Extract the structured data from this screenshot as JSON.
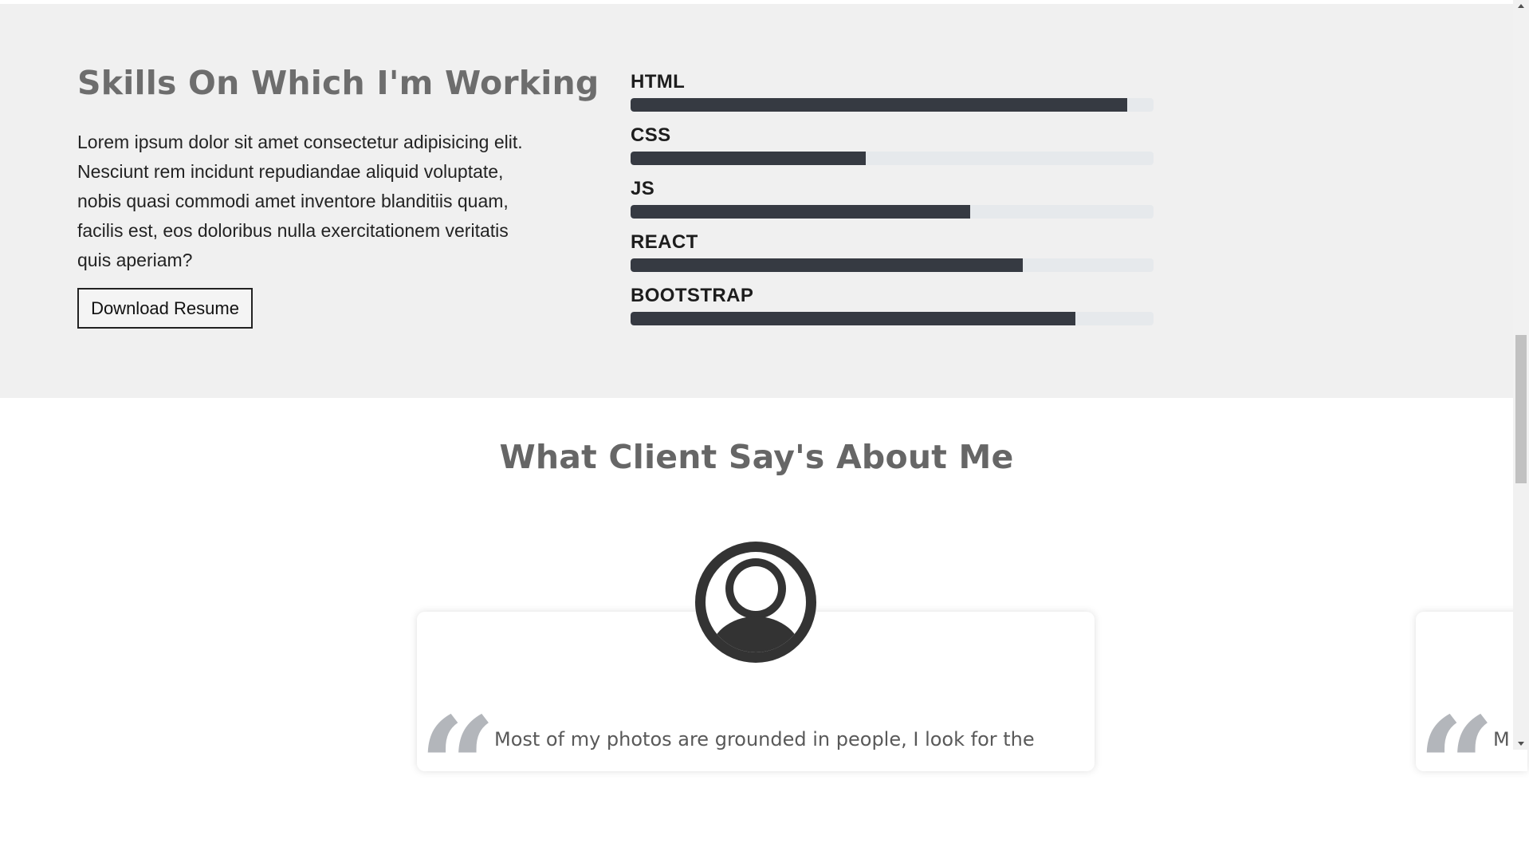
{
  "skills_section": {
    "title": "Skills On Which I'm Working",
    "description": "Lorem ipsum dolor sit amet consectetur adipisicing elit. Nesciunt rem incidunt repudiandae aliquid voluptate, nobis quasi commodi amet inventore blanditiis quam, facilis est, eos doloribus nulla exercitationem veritatis quis aperiam?",
    "resume_button": "Download Resume",
    "skills": [
      {
        "label": "HTML",
        "percent": 95
      },
      {
        "label": "CSS",
        "percent": 45
      },
      {
        "label": "JS",
        "percent": 65
      },
      {
        "label": "REACT",
        "percent": 75
      },
      {
        "label": "BOOTSTRAP",
        "percent": 85
      }
    ],
    "bar_color": "#363a42",
    "track_color": "#e6e9ec"
  },
  "testimonials": {
    "title": "What Client Say's About Me",
    "cards": [
      {
        "avatar_icon": "user-avatar-icon",
        "quote_icon": "quote-icon",
        "text": "Most of my photos are grounded in people, I look for the"
      },
      {
        "quote_icon": "quote-icon",
        "text": "M"
      }
    ]
  },
  "colors": {
    "section_bg": "#f0f0f0",
    "heading": "#6d6d6d"
  }
}
